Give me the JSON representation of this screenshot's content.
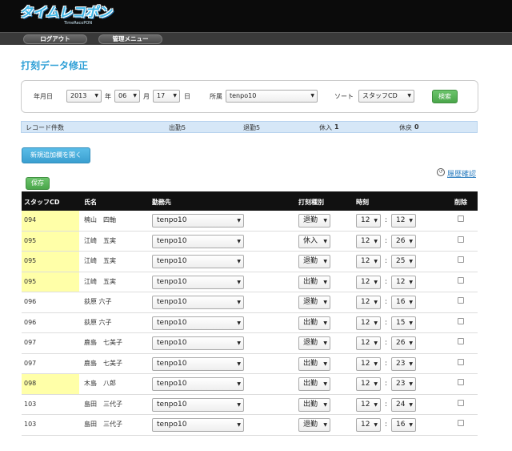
{
  "header": {
    "logo_text": "タイムレコポン",
    "logo_sub": "TimeRecoPON",
    "nav": [
      {
        "label": "ログアウト"
      },
      {
        "label": "管理メニュー"
      }
    ]
  },
  "page_title": "打刻データ修正",
  "search": {
    "date_label": "年月日",
    "year": "2013",
    "year_unit": "年",
    "month": "06",
    "month_unit": "月",
    "day": "17",
    "day_unit": "日",
    "dept_label": "所属",
    "dept": "tenpo10",
    "sort_label": "ソート",
    "sort": "スタッフCD",
    "search_button": "検索"
  },
  "record_bar": {
    "count_label": "レコード件数",
    "in_label": "出勤5",
    "out_label": "退勤5",
    "break_in_label": "休入",
    "break_in_value": "1",
    "break_out_label": "休戻",
    "break_out_value": "0"
  },
  "add_button": "新規追加欄を開く",
  "history_link": "履歴確認",
  "save_button": "保存",
  "table": {
    "headers": [
      "スタッフCD",
      "氏名",
      "勤務先",
      "打刻種別",
      "時刻",
      "削除"
    ],
    "rows": [
      {
        "cd": "094",
        "name": "楠山　四軸",
        "place": "tenpo10",
        "type": "退勤",
        "hour": "12",
        "min": "12",
        "hl": true
      },
      {
        "cd": "095",
        "name": "江崎　五実",
        "place": "tenpo10",
        "type": "休入",
        "hour": "12",
        "min": "26",
        "hl": true
      },
      {
        "cd": "095",
        "name": "江崎　五実",
        "place": "tenpo10",
        "type": "退勤",
        "hour": "12",
        "min": "25",
        "hl": true
      },
      {
        "cd": "095",
        "name": "江崎　五実",
        "place": "tenpo10",
        "type": "出勤",
        "hour": "12",
        "min": "12",
        "hl": true
      },
      {
        "cd": "096",
        "name": "荻原 六子",
        "place": "tenpo10",
        "type": "退勤",
        "hour": "12",
        "min": "16",
        "hl": false
      },
      {
        "cd": "096",
        "name": "荻原 六子",
        "place": "tenpo10",
        "type": "出勤",
        "hour": "12",
        "min": "15",
        "hl": false
      },
      {
        "cd": "097",
        "name": "鹿島　七美子",
        "place": "tenpo10",
        "type": "退勤",
        "hour": "12",
        "min": "26",
        "hl": false
      },
      {
        "cd": "097",
        "name": "鹿島　七美子",
        "place": "tenpo10",
        "type": "出勤",
        "hour": "12",
        "min": "23",
        "hl": false
      },
      {
        "cd": "098",
        "name": "木島　八郎",
        "place": "tenpo10",
        "type": "出勤",
        "hour": "12",
        "min": "23",
        "hl": true
      },
      {
        "cd": "103",
        "name": "島田　三代子",
        "place": "tenpo10",
        "type": "出勤",
        "hour": "12",
        "min": "24",
        "hl": false
      },
      {
        "cd": "103",
        "name": "島田　三代子",
        "place": "tenpo10",
        "type": "退勤",
        "hour": "12",
        "min": "16",
        "hl": false
      }
    ]
  }
}
